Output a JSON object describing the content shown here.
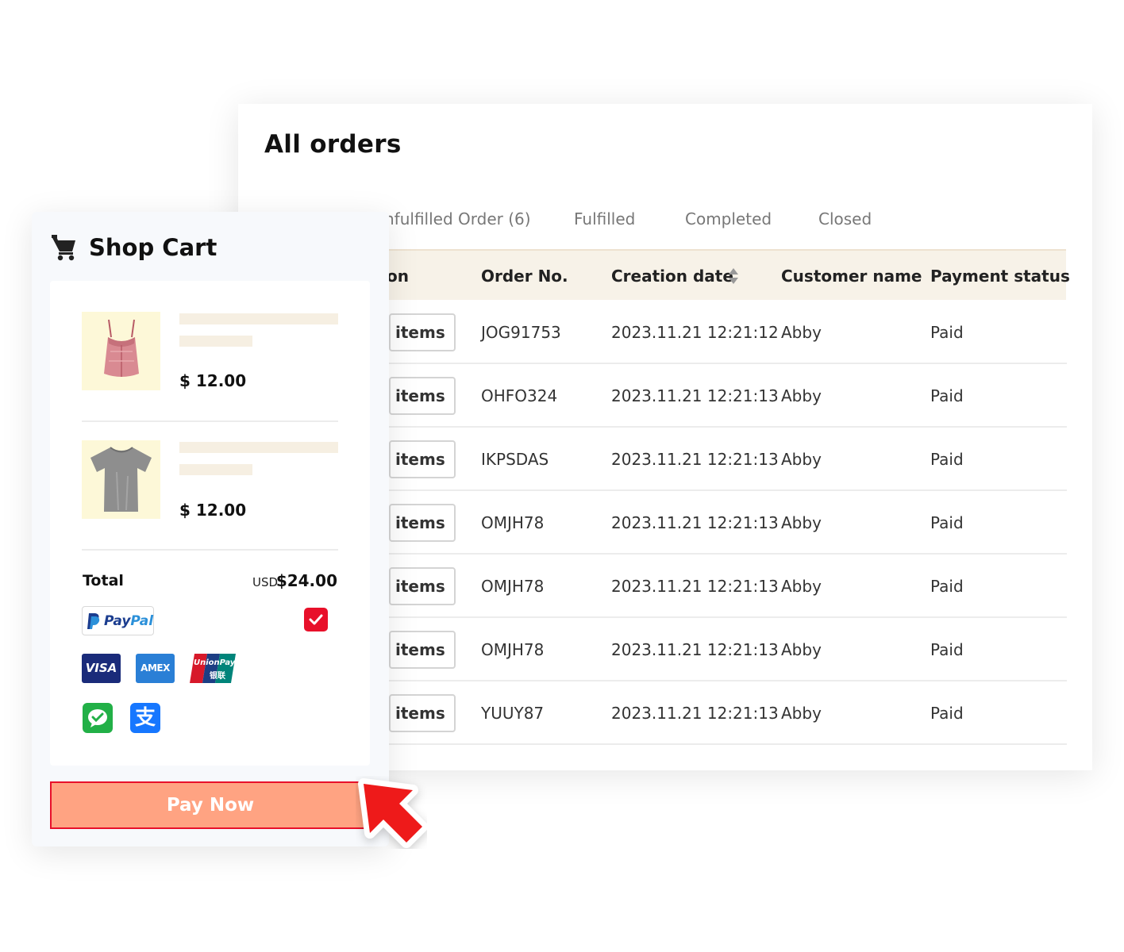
{
  "orders": {
    "title": "All orders",
    "tabs": [
      "nfulfilled Order (6)",
      "Fulfilled",
      "Completed",
      "Closed"
    ],
    "columns": [
      "on",
      "Order No.",
      "Creation date",
      "Customer name",
      "Payment status"
    ],
    "rows": [
      {
        "action": "items",
        "order_no": "JOG91753",
        "date": "2023.11.21 12:21:12",
        "customer": "Abby",
        "payment": "Paid"
      },
      {
        "action": "items",
        "order_no": "OHFO324",
        "date": "2023.11.21 12:21:13",
        "customer": "Abby",
        "payment": "Paid"
      },
      {
        "action": "items",
        "order_no": "IKPSDAS",
        "date": "2023.11.21 12:21:13",
        "customer": "Abby",
        "payment": "Paid"
      },
      {
        "action": "items",
        "order_no": "OMJH78",
        "date": "2023.11.21 12:21:13",
        "customer": "Abby",
        "payment": "Paid"
      },
      {
        "action": "items",
        "order_no": "OMJH78",
        "date": "2023.11.21 12:21:13",
        "customer": "Abby",
        "payment": "Paid"
      },
      {
        "action": "items",
        "order_no": "OMJH78",
        "date": "2023.11.21 12:21:13",
        "customer": "Abby",
        "payment": "Paid"
      },
      {
        "action": "items",
        "order_no": "YUUY87",
        "date": "2023.11.21 12:21:13",
        "customer": "Abby",
        "payment": "Paid"
      }
    ]
  },
  "cart": {
    "title": "Shop Cart",
    "items": [
      {
        "price": "$ 12.00",
        "image": "pink-top"
      },
      {
        "price": "$ 12.00",
        "image": "grey-tshirt"
      }
    ],
    "total_label": "Total",
    "currency": "USD",
    "total": "$24.00",
    "payment_methods": {
      "paypal": "PayPal",
      "visa": "VISA",
      "amex": "AMEX",
      "unionpay": "UnionPay",
      "unionpay_cn": "银联",
      "wechat": "wechat-pay-icon",
      "alipay": "支"
    },
    "pay_button": "Pay Now"
  },
  "colors": {
    "accent_red": "#e8102a",
    "pay_button": "#ffa382",
    "table_header": "#f7f2e8",
    "thumb_bg": "#fdf8d8"
  }
}
